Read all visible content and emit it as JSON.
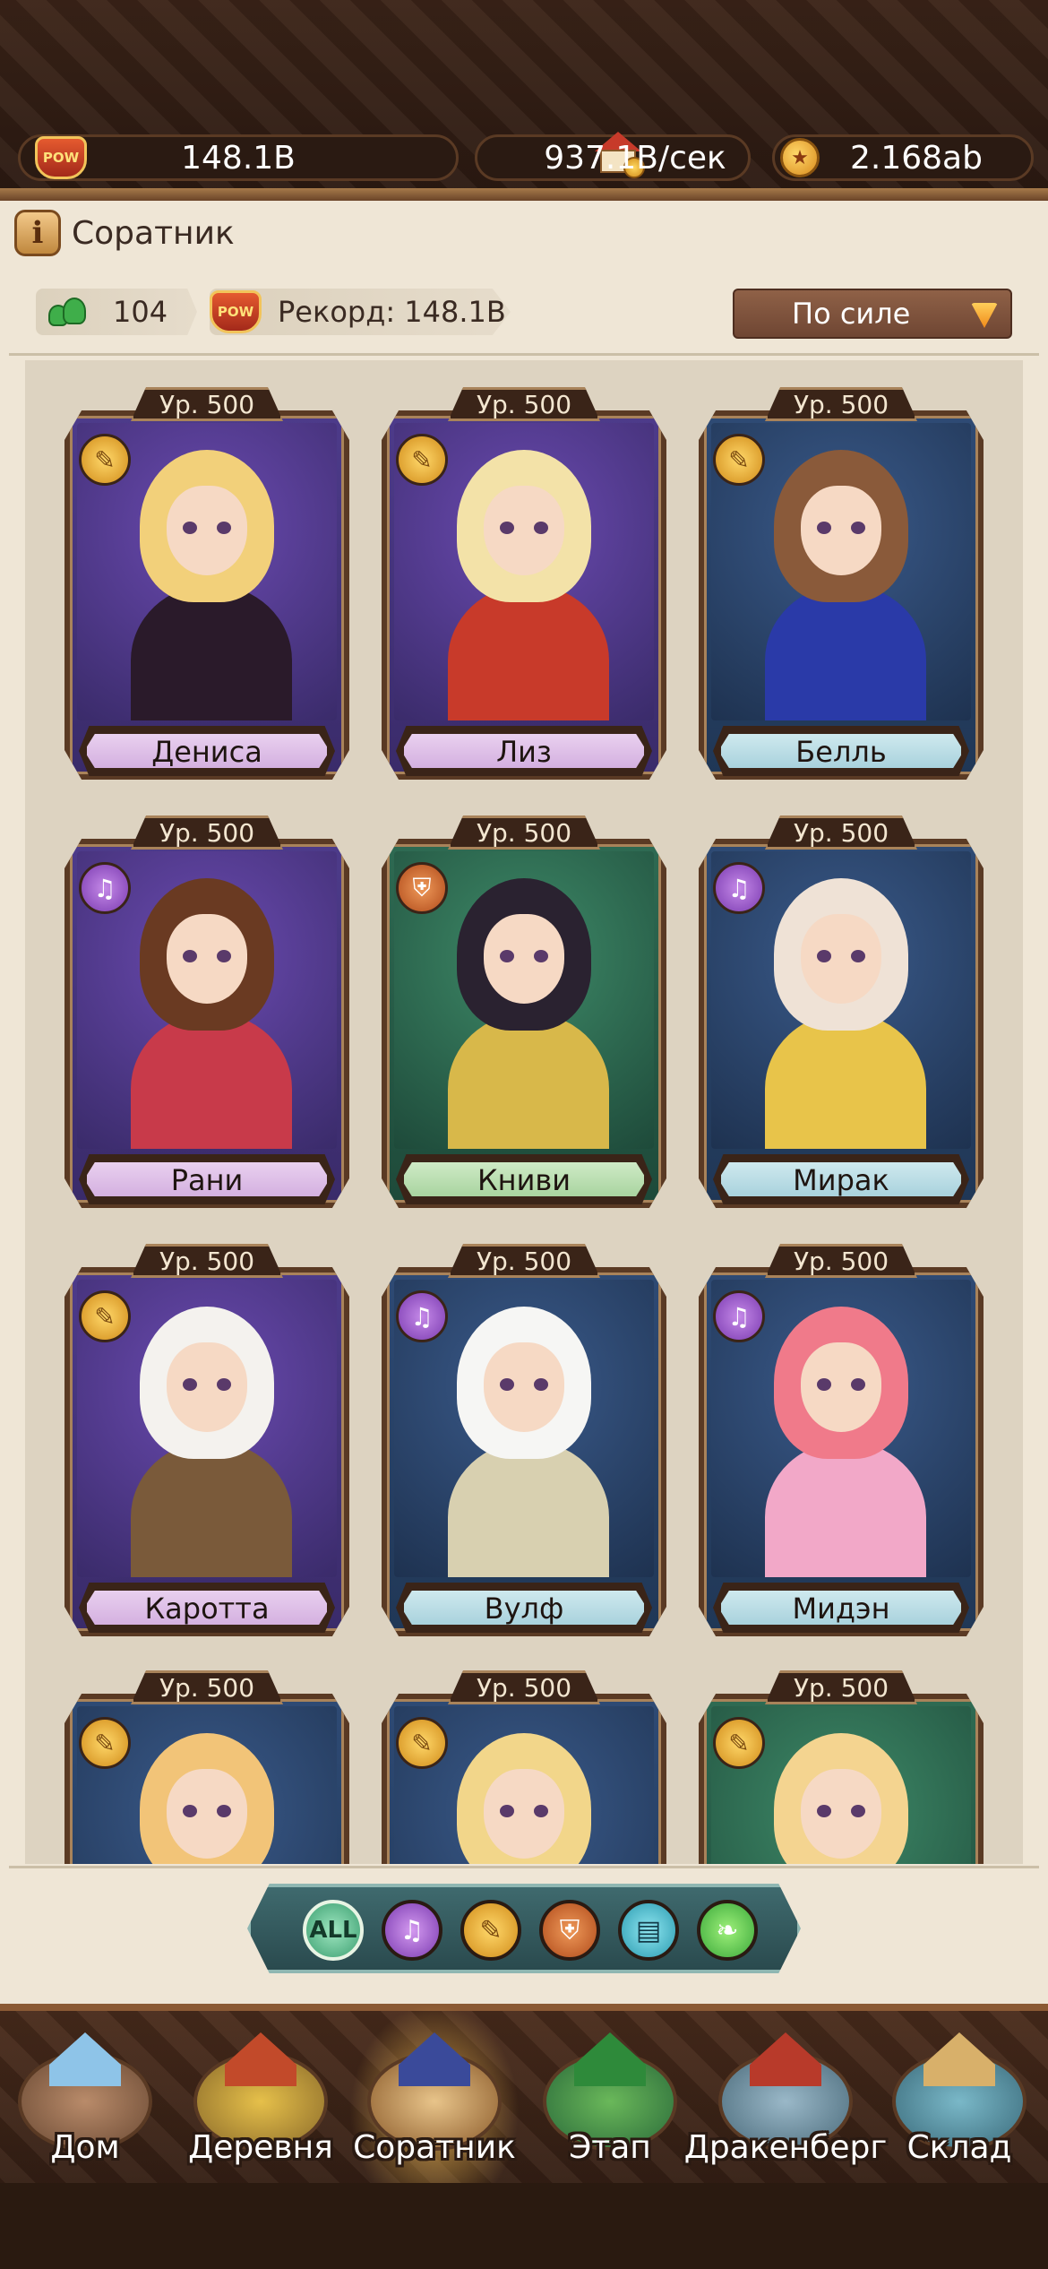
{
  "resources": {
    "power": "148.1B",
    "income": "937.1B/сек",
    "coins": "2.168ab",
    "power_icon_text": "POW"
  },
  "header": {
    "title": "Соратник",
    "info_icon": "i"
  },
  "stats": {
    "count": "104",
    "record_label": "Рекорд: 148.1B"
  },
  "sort": {
    "selected": "По силе"
  },
  "cards": [
    {
      "level": "Ур. 500",
      "name": "Дениса",
      "class_icon": "broom-icon",
      "theme": "purple",
      "plate": "purple"
    },
    {
      "level": "Ур. 500",
      "name": "Лиз",
      "class_icon": "broom-icon",
      "theme": "purple",
      "plate": "purple"
    },
    {
      "level": "Ур. 500",
      "name": "Белль",
      "class_icon": "broom-icon",
      "theme": "blue",
      "plate": "blue"
    },
    {
      "level": "Ур. 500",
      "name": "Рани",
      "class_icon": "harp-icon",
      "theme": "purple",
      "plate": "purple"
    },
    {
      "level": "Ур. 500",
      "name": "Книви",
      "class_icon": "shield-icon",
      "theme": "green",
      "plate": "green"
    },
    {
      "level": "Ур. 500",
      "name": "Мирак",
      "class_icon": "harp-icon",
      "theme": "blue",
      "plate": "blue"
    },
    {
      "level": "Ур. 500",
      "name": "Каротта",
      "class_icon": "broom-icon",
      "theme": "purple",
      "plate": "purple"
    },
    {
      "level": "Ур. 500",
      "name": "Вулф",
      "class_icon": "harp-icon",
      "theme": "blue",
      "plate": "blue"
    },
    {
      "level": "Ур. 500",
      "name": "Мидэн",
      "class_icon": "harp-icon",
      "theme": "blue",
      "plate": "blue"
    },
    {
      "level": "Ур. 500",
      "name": "",
      "class_icon": "broom-icon",
      "theme": "blue",
      "plate": "blue"
    },
    {
      "level": "Ур. 500",
      "name": "",
      "class_icon": "broom-icon",
      "theme": "blue",
      "plate": "blue"
    },
    {
      "level": "Ур. 500",
      "name": "",
      "class_icon": "broom-icon",
      "theme": "green",
      "plate": "green"
    }
  ],
  "filters": {
    "all_label": "ALL",
    "items": [
      "all-filter",
      "harp-filter",
      "broom-filter",
      "shield-filter",
      "book-filter",
      "wing-filter"
    ]
  },
  "nav": {
    "items": [
      {
        "label": "Дом"
      },
      {
        "label": "Деревня"
      },
      {
        "label": "Соратник"
      },
      {
        "label": "Этап"
      },
      {
        "label": "Дракенберг"
      },
      {
        "label": "Склад"
      }
    ],
    "active_index": 2
  },
  "colors": {
    "panel_bg": "#efe6d6",
    "frame_brown": "#5a3a24",
    "accent_gold": "#f2c45a"
  }
}
